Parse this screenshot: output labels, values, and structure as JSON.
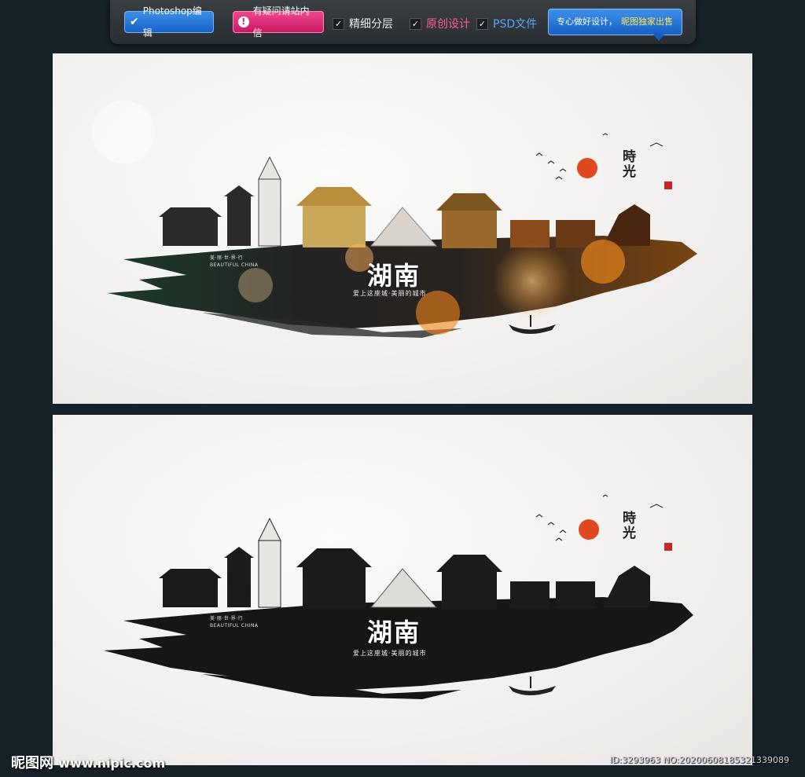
{
  "toolbar": {
    "photoshop_label": "Photoshop编辑",
    "ask_label": "有疑问请站内信",
    "feature_layers": "精细分层",
    "feature_original": "原创设计",
    "feature_psd": "PSD文件",
    "promo_prefix": "专心做好设计，",
    "promo_highlight": "昵图独家出售"
  },
  "poster": {
    "title": "湖南",
    "slogan": "爱上这座城·美丽的城市",
    "tagline": "美·丽·世·界·行",
    "tagline_en": "BEAUTIFUL CHINA",
    "side_title": "時光"
  },
  "watermark": {
    "brand": "昵图网",
    "url": "www.nipic.com",
    "id_text": "ID:3293963 NO:20200608185321339089"
  },
  "colors": {
    "ink": "#1c1c1c",
    "sun": "#e0481f",
    "bokeh_orange": "#f08a1d",
    "green_tint": "#2f4a33"
  }
}
